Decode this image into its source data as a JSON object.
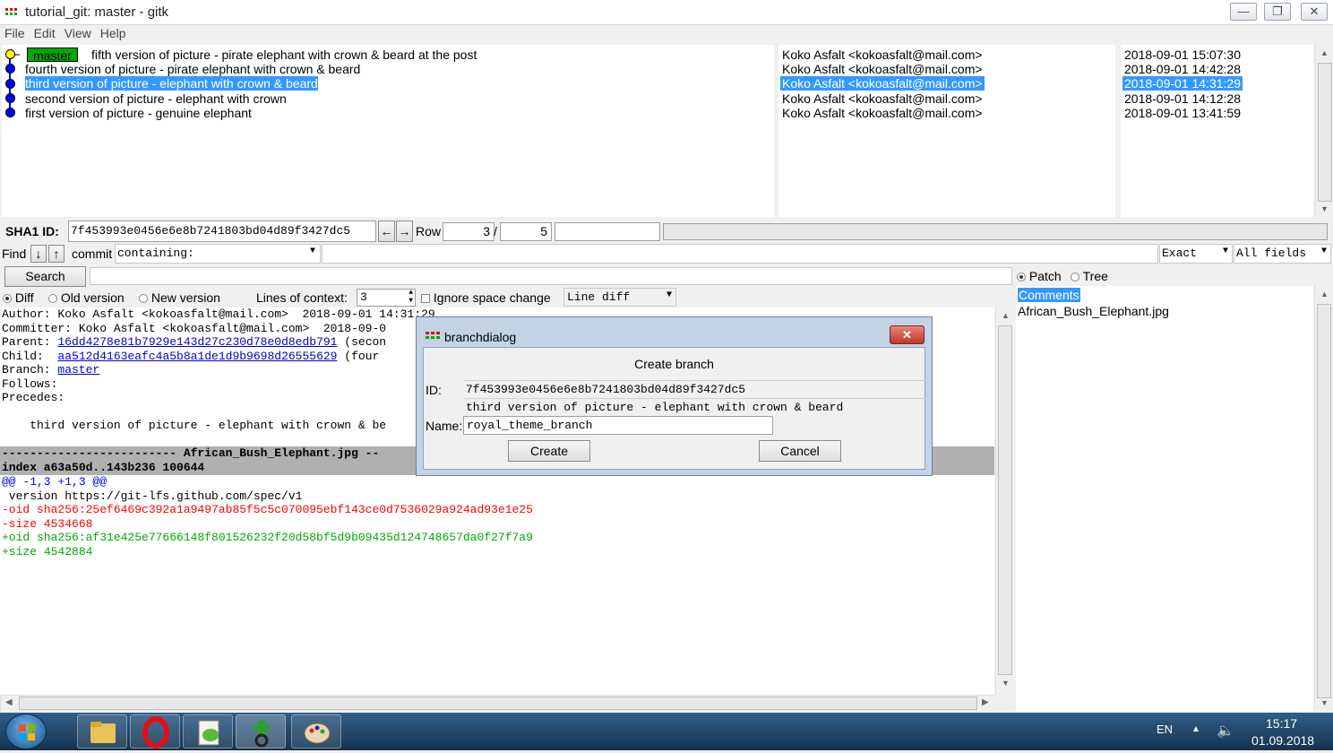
{
  "window": {
    "title": "tutorial_git: master - gitk",
    "minimize": "—",
    "restore": "❐",
    "close": "✕"
  },
  "menu": [
    "File",
    "Edit",
    "View",
    "Help"
  ],
  "commits": [
    {
      "subject": "fifth version of picture - pirate elephant with crown & beard at the post",
      "branch": "master",
      "author": "Koko Asfalt <kokoasfalt@mail.com>",
      "date": "2018-09-01 15:07:30"
    },
    {
      "subject": "fourth version of picture - pirate elephant with crown & beard",
      "author": "Koko Asfalt <kokoasfalt@mail.com>",
      "date": "2018-09-01 14:42:28"
    },
    {
      "subject": "third version of picture - elephant with crown & beard",
      "author": "Koko Asfalt <kokoasfalt@mail.com>",
      "date": "2018-09-01 14:31:29",
      "selected": true
    },
    {
      "subject": "second version of picture - elephant with crown",
      "author": "Koko Asfalt <kokoasfalt@mail.com>",
      "date": "2018-09-01 14:12:28"
    },
    {
      "subject": "first version of picture - genuine elephant",
      "author": "Koko Asfalt <kokoasfalt@mail.com>",
      "date": "2018-09-01 13:41:59"
    }
  ],
  "sha": {
    "label": "SHA1 ID:",
    "value": "7f453993e0456e6e8b7241803bd04d89f3427dc5",
    "row_label": "Row",
    "row": "3",
    "sep": "/",
    "total": "5"
  },
  "find": {
    "label": "Find",
    "type": "commit",
    "mode": "containing:",
    "match": "Exact",
    "fields": "All fields"
  },
  "search": {
    "button": "Search"
  },
  "diffopts": {
    "diff": "Diff",
    "old": "Old version",
    "new": "New version",
    "context_label": "Lines of context:",
    "context": "3",
    "ignore_ws": "Ignore space change",
    "diff_mode": "Line diff"
  },
  "rightpane": {
    "patch": "Patch",
    "tree": "Tree",
    "files": [
      "Comments",
      "African_Bush_Elephant.jpg"
    ]
  },
  "details": {
    "author": "Author: Koko Asfalt <kokoasfalt@mail.com>  2018-09-01 14:31:29",
    "committer": "Committer: Koko Asfalt <kokoasfalt@mail.com>  2018-09-0",
    "parent_label": "Parent: ",
    "parent_sha": "16dd4278e81b7929e143d27c230d78e0d8edb791",
    "parent_tail": " (secon",
    "child_label": "Child:  ",
    "child_sha": "aa512d4163eafc4a5b8a1de1d9b9698d26555629",
    "child_tail": " (four",
    "branch_label": "Branch: ",
    "branch": "master",
    "follows": "Follows:",
    "precedes": "Precedes:",
    "message": "    third version of picture - elephant with crown & be",
    "file_header": "------------------------- African_Bush_Elephant.jpg --",
    "index": "index a63a50d..143b236 100644",
    "hunk": "@@ -1,3 +1,3 @@",
    "ctx": " version https://git-lfs.github.com/spec/v1",
    "del1": "-oid sha256:25ef6469c392a1a9497ab85f5c5c070095ebf143ce0d7536029a924ad93e1e25",
    "del2": "-size 4534668",
    "add1": "+oid sha256:af31e425e77666148f801526232f20d58bf5d9b09435d124748657da0f27f7a9",
    "add2": "+size 4542884"
  },
  "dialog": {
    "title": "branchdialog",
    "heading": "Create branch",
    "id_label": "ID:",
    "id_value": "7f453993e0456e6e8b7241803bd04d89f3427dc5",
    "subject": "third version of picture - elephant with crown & beard",
    "name_label": "Name:",
    "name_value": "royal_theme_branch",
    "create": "Create",
    "cancel": "Cancel",
    "close": "✕"
  },
  "taskbar": {
    "lang": "EN",
    "time": "15:17",
    "date": "01.09.2018"
  },
  "colors": {
    "selection": "#3399ff",
    "branch_tag": "#00aa00",
    "deleted": "#ff0000",
    "added": "#00aa00",
    "hunk": "#0000ff"
  }
}
